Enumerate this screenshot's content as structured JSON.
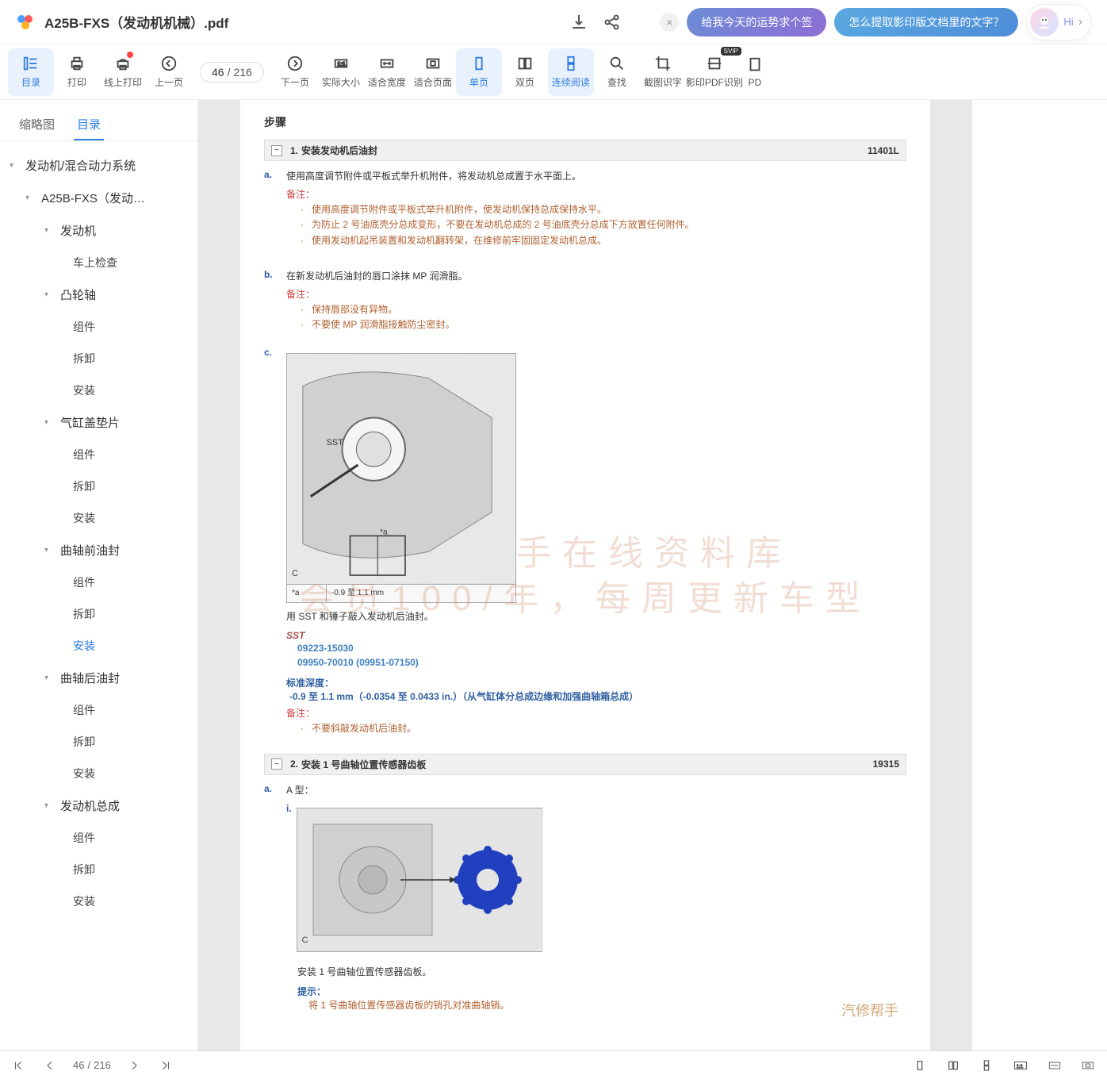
{
  "header": {
    "title": "A25B-FXS（发动机机械）.pdf",
    "promo_close": "×",
    "promo1": "给我今天的运势求个签",
    "promo2": "怎么提取影印版文档里的文字？",
    "avatar_hi": "Hi",
    "avatar_arrow": "›"
  },
  "toolbar": {
    "toc": "目录",
    "print": "打印",
    "online_print": "线上打印",
    "prev": "上一页",
    "page_current": "46",
    "page_sep": "/",
    "page_total": "216",
    "next": "下一页",
    "actual": "实际大小",
    "fit_width": "适合宽度",
    "fit_page": "适合页面",
    "single": "单页",
    "double": "双页",
    "continuous": "连续阅读",
    "find": "查找",
    "ocr_image": "截图识字",
    "scan_ocr": "影印PDF识别",
    "svip": "SVIP",
    "pdf_partial": "PD"
  },
  "sidebar": {
    "tab_thumb": "缩略图",
    "tab_toc": "目录",
    "tree": {
      "n0": "发动机/混合动力系统",
      "n1": "A25B-FXS（发动…",
      "n2": "发动机",
      "n2_1": "车上检查",
      "n3": "凸轮轴",
      "n3_1": "组件",
      "n3_2": "拆卸",
      "n3_3": "安装",
      "n4": "气缸盖垫片",
      "n4_1": "组件",
      "n4_2": "拆卸",
      "n4_3": "安装",
      "n5": "曲轴前油封",
      "n5_1": "组件",
      "n5_2": "拆卸",
      "n5_3": "安装",
      "n6": "曲轴后油封",
      "n6_1": "组件",
      "n6_2": "拆卸",
      "n6_3": "安装",
      "n7": "发动机总成",
      "n7_1": "组件",
      "n7_2": "拆卸",
      "n7_3": "安装"
    }
  },
  "doc": {
    "step_title": "步骤",
    "sec1_num": "1.",
    "sec1_title": "安装发动机后油封",
    "sec1_code": "11401L",
    "step_a": "a.",
    "step_a_text": "使用高度调节附件或平板式举升机附件，将发动机总成置于水平面上。",
    "note_label1": "备注：",
    "note_a_1": "使用高度调节附件或平板式举升机附件，使发动机保持总成保持水平。",
    "note_a_2": "为防止 2 号油底壳分总成变形，不要在发动机总成的 2 号油底壳分总成下方放置任何附件。",
    "note_a_3": "使用发动机起吊装置和发动机翻转架，在维修前牢固固定发动机总成。",
    "step_b": "b.",
    "step_b_text": "在新发动机后油封的唇口涂抹 MP 润滑脂。",
    "note_label2": "备注：",
    "note_b_1": "保持唇部没有异物。",
    "note_b_2": "不要使 MP 润滑脂接触防尘密封。",
    "step_c": "c.",
    "diagram_a": "*a",
    "diagram_val": "-0.9 至 1.1 mm",
    "diagram_c": "C",
    "sst_marker": "SST",
    "after_diagram": "用 SST 和锤子敲入发动机后油封。",
    "sst_label": "SST",
    "sst_code1": "09223-15030",
    "sst_code2": "09950-70010  (09951-07150)",
    "depth_label": "标准深度：",
    "depth_val": " -0.9 至 1.1 mm（-0.0354 至 0.0433 in.）（从气缸体分总成边缘和加强曲轴箱总成）",
    "note_label3": "备注：",
    "note_c_1": "不要斜敲发动机后油封。",
    "sec2_num": "2.",
    "sec2_title": "安装 1 号曲轴位置传感器齿板",
    "sec2_code": "19315",
    "step_a2": "a.",
    "step_a2_text": "A 型：",
    "step_a2_i": "i.",
    "after_diagram2": "安装 1 号曲轴位置传感器齿板。",
    "hint_label": "提示：",
    "hint_text": "将 1 号曲轴位置传感器齿板的销孔对准曲轴销。",
    "watermark_line1": "汽修帮手在线资料库",
    "watermark_line2": "会员100/年，每周更新车型",
    "brand": "汽修帮手"
  },
  "footer": {
    "page_cur": "46",
    "page_sep": "/",
    "page_total": "216"
  }
}
